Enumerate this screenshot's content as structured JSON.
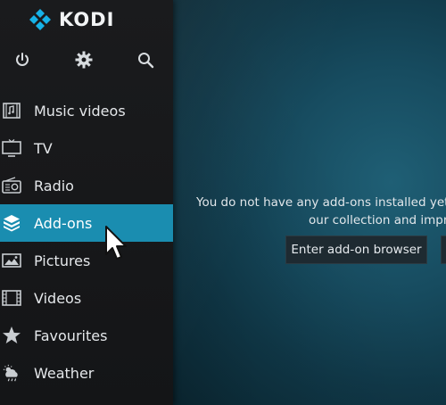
{
  "app": {
    "title": "KODI"
  },
  "top_icons": [
    {
      "name": "power-icon"
    },
    {
      "name": "gear-icon"
    },
    {
      "name": "search-icon"
    }
  ],
  "menu": {
    "items": [
      {
        "label": "Music videos",
        "icon": "music-video-icon"
      },
      {
        "label": "TV",
        "icon": "tv-icon"
      },
      {
        "label": "Radio",
        "icon": "radio-icon"
      },
      {
        "label": "Add-ons",
        "icon": "addons-box-icon",
        "active": true
      },
      {
        "label": "Pictures",
        "icon": "pictures-icon"
      },
      {
        "label": "Videos",
        "icon": "film-icon"
      },
      {
        "label": "Favourites",
        "icon": "star-icon"
      },
      {
        "label": "Weather",
        "icon": "weather-icon"
      }
    ]
  },
  "main": {
    "message_line1": "You do not have any add-ons installed yet",
    "message_line2": "our collection and impr",
    "browser_button": "Enter add-on browser"
  },
  "colors": {
    "active_item": "#1a8db0",
    "sidebar_bg": "#1a1b1d",
    "main_bg": "#174c60",
    "logo_blue": "#17b2e7"
  }
}
